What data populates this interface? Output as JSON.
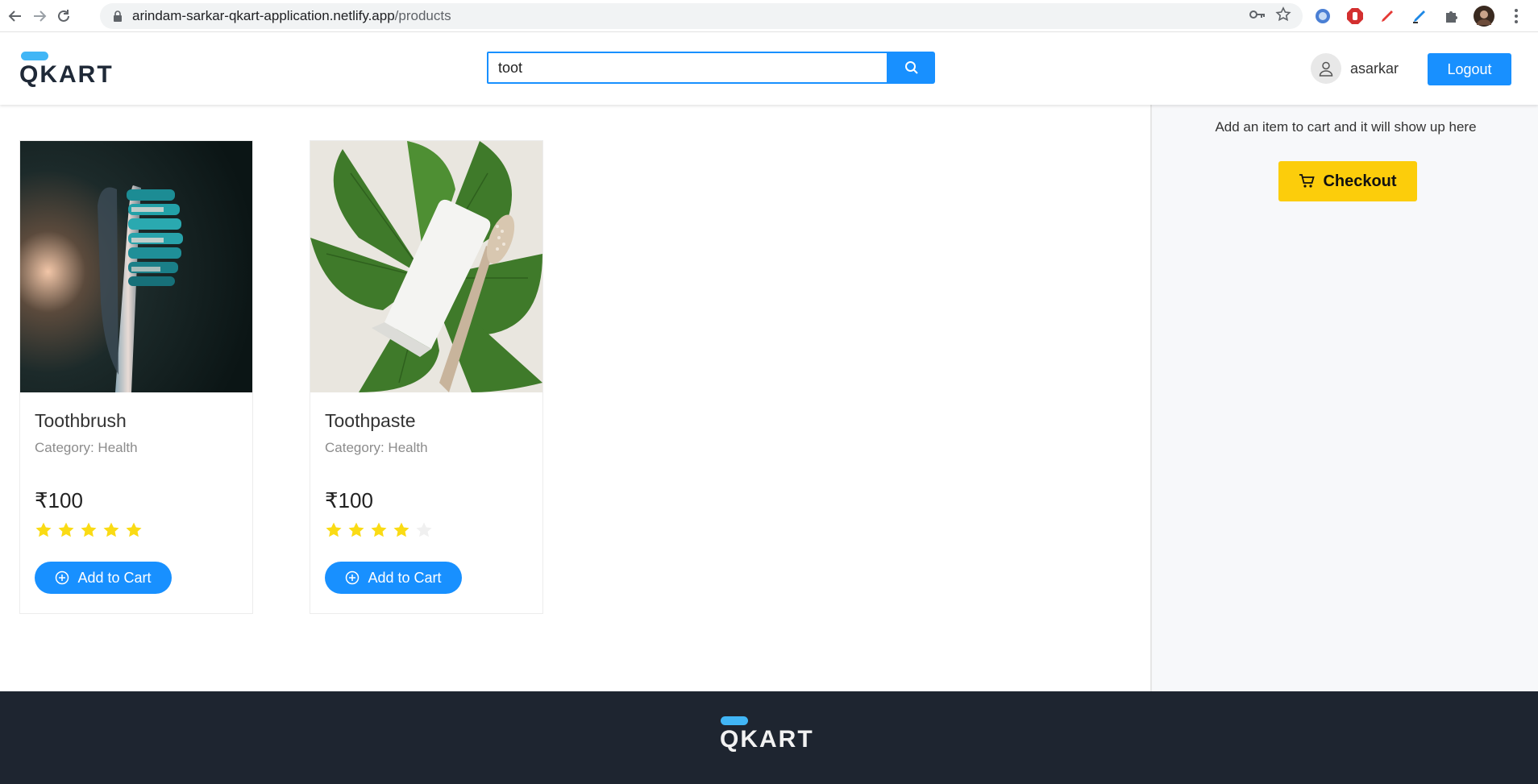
{
  "browser": {
    "url_host": "arindam-sarkar-qkart-application.netlify.app",
    "url_path": "/products"
  },
  "header": {
    "logo_text": "QKART",
    "search_value": "toot",
    "username": "asarkar",
    "logout_label": "Logout"
  },
  "products": [
    {
      "name": "Toothbrush",
      "category": "Category: Health",
      "price": "₹100",
      "rating": 5,
      "add_label": "Add to Cart"
    },
    {
      "name": "Toothpaste",
      "category": "Category: Health",
      "price": "₹100",
      "rating": 4,
      "add_label": "Add to Cart"
    }
  ],
  "cart": {
    "empty_message": "Add an item to cart and it will show up here",
    "checkout_label": "Checkout"
  },
  "footer": {
    "logo_text": "QKART"
  },
  "colors": {
    "primary": "#1890ff",
    "checkout": "#fccd0b",
    "star": "#fadb14",
    "footer_bg": "#1e2530",
    "logo_pill": "#41b6f6"
  }
}
